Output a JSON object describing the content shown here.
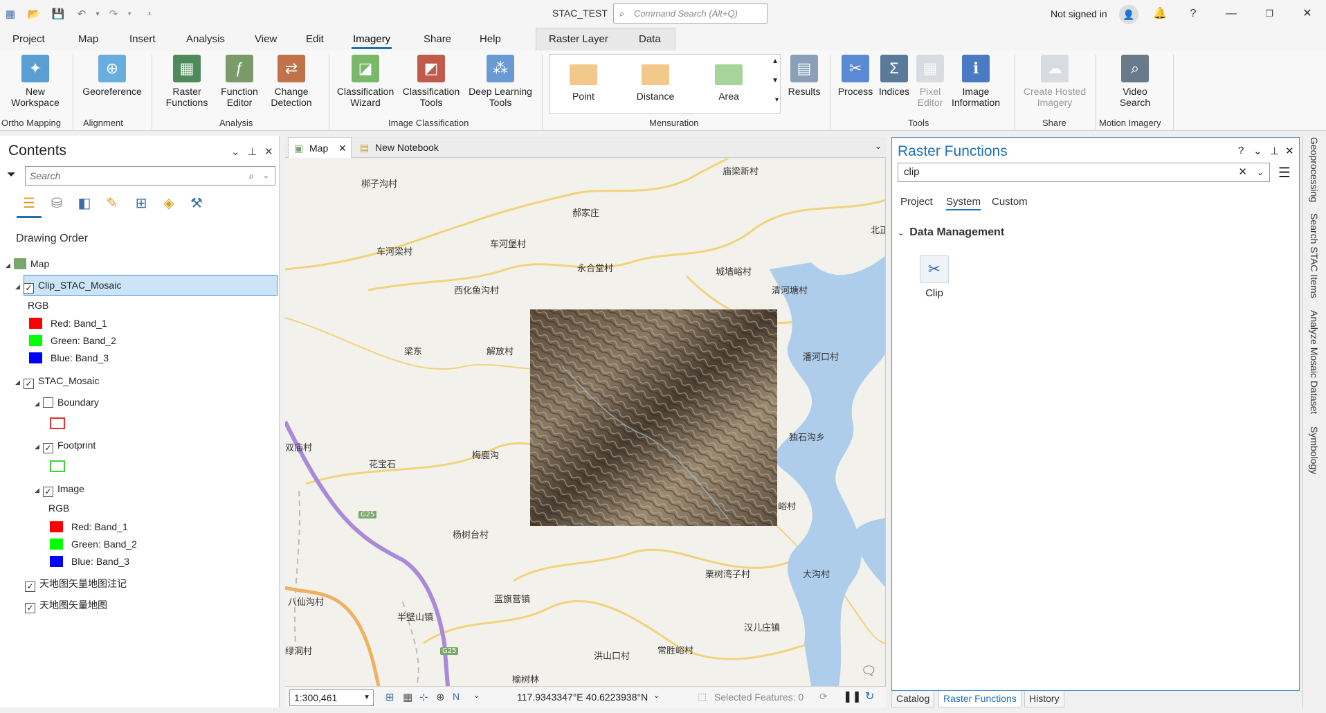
{
  "window": {
    "title": "STAC_TEST",
    "command_search_placeholder": "Command Search (Alt+Q)",
    "signin": "Not signed in"
  },
  "menu": {
    "tabs": [
      "Project",
      "Map",
      "Insert",
      "Analysis",
      "View",
      "Edit",
      "Imagery",
      "Share",
      "Help"
    ],
    "active": "Imagery",
    "context_tabs": [
      "Raster Layer",
      "Data"
    ]
  },
  "ribbon": {
    "new_workspace": "New\nWorkspace",
    "georeference": "Georeference",
    "raster_functions": "Raster\nFunctions",
    "function_editor": "Function\nEditor",
    "change_detection": "Change\nDetection",
    "classification_wizard": "Classification\nWizard",
    "classification_tools": "Classification\nTools",
    "deep_learning_tools": "Deep Learning\nTools",
    "point": "Point",
    "distance": "Distance",
    "area": "Area",
    "results": "Results",
    "process": "Process",
    "indices": "Indices",
    "pixel_editor": "Pixel\nEditor",
    "image_information": "Image\nInformation",
    "create_hosted_imagery": "Create Hosted\nImagery",
    "video_search": "Video\nSearch",
    "groups": {
      "ortho_mapping": "Ortho Mapping",
      "alignment": "Alignment",
      "analysis": "Analysis",
      "image_classification": "Image Classification",
      "mensuration": "Mensuration",
      "tools": "Tools",
      "share": "Share",
      "motion_imagery": "Motion Imagery"
    }
  },
  "contents": {
    "title": "Contents",
    "search_placeholder": "Search",
    "drawing_order": "Drawing Order",
    "map": "Map",
    "clip_layer": "Clip_STAC_Mosaic",
    "rgb": "RGB",
    "red": "Red:",
    "green": "Green:",
    "blue": "Blue:",
    "band1": "Band_1",
    "band2": "Band_2",
    "band3": "Band_3",
    "stac_mosaic": "STAC_Mosaic",
    "boundary": "Boundary",
    "footprint": "Footprint",
    "image": "Image",
    "tianditu_annot": "天地图矢量地图注记",
    "tianditu_map": "天地图矢量地图",
    "colors": {
      "red": "#ff0000",
      "green": "#00ff00",
      "blue": "#0000ff"
    }
  },
  "map_view": {
    "tab_map": "Map",
    "tab_notebook": "New Notebook",
    "scale": "1:300,461",
    "coords": "117.9343347°E 40.6223938°N",
    "selected_features": "Selected Features: 0",
    "places": {
      "p1": "梆子沟村",
      "p2": "庙梁新村",
      "p3": "郝家庄",
      "p4": "车河梁村",
      "p5": "车河堡村",
      "p6": "永合堂村",
      "p7": "城墙峪村",
      "p8": "北正",
      "p9": "西化鱼沟村",
      "p10": "清河塘村",
      "p11": "梁东",
      "p12": "解放村",
      "p13": "潘河口村",
      "p14": "双庙村",
      "p15": "花宝石",
      "p16": "梅鹿沟",
      "p17": "独石沟乡",
      "p18": "峪村",
      "p19": "杨树台村",
      "p20": "栗树湾子村",
      "p21": "大沟村",
      "p22": "八仙沟村",
      "p23": "蓝旗营镇",
      "p24": "半壁山镇",
      "p25": "汉儿庄镇",
      "p26": "绿洞村",
      "p27": "洪山口村",
      "p28": "常胜峪村",
      "p29": "榆树林",
      "g1": "G25",
      "g2": "G25"
    }
  },
  "raster_functions": {
    "title": "Raster Functions",
    "search_value": "clip",
    "tabs": [
      "Project",
      "System",
      "Custom"
    ],
    "active_tab": "System",
    "category": "Data Management",
    "item": "Clip"
  },
  "bottom_tabs": [
    "Catalog",
    "Raster Functions",
    "History"
  ],
  "side_tabs": [
    "Geoprocessing",
    "Search STAC Items",
    "Analyze Mosaic Dataset",
    "Symbology"
  ]
}
